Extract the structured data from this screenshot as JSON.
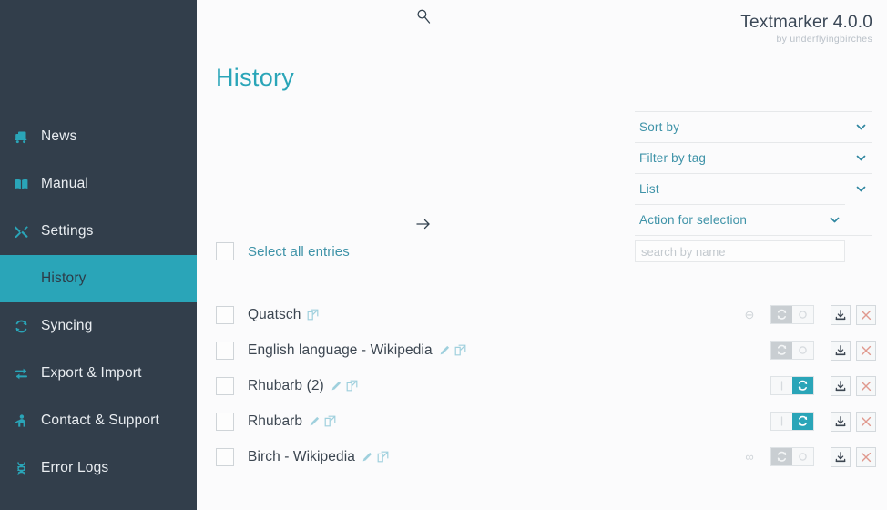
{
  "app": {
    "title": "Textmarker 4.0.0",
    "subtitle": "by underflyingbirches",
    "accent_color": "#2aa5b8",
    "sidebar_color": "#323e4b",
    "background_color": "#fbfbfc"
  },
  "page": {
    "title": "History"
  },
  "sidebar": {
    "items": [
      {
        "label": "News",
        "icon": "news-icon",
        "active": false
      },
      {
        "label": "Manual",
        "icon": "book-icon",
        "active": false
      },
      {
        "label": "Settings",
        "icon": "tools-icon",
        "active": false
      },
      {
        "label": "History",
        "icon": "history-icon",
        "active": true
      },
      {
        "label": "Syncing",
        "icon": "sync-icon",
        "active": false
      },
      {
        "label": "Export & Import",
        "icon": "swap-icon",
        "active": false
      },
      {
        "label": "Contact & Support",
        "icon": "person-icon",
        "active": false
      },
      {
        "label": "Error Logs",
        "icon": "dna-icon",
        "active": false
      }
    ]
  },
  "filters": {
    "sort_by_label": "Sort by",
    "filter_by_tag_label": "Filter by tag",
    "list_label": "List",
    "action_for_selection_label": "Action for selection",
    "go_icon": "arrow-right-icon",
    "chevron_icon": "chevron-down-icon"
  },
  "search": {
    "value": "",
    "placeholder": "search by name",
    "icon": "magnifier-icon"
  },
  "selection": {
    "select_all_label": "Select all entries",
    "checked": false
  },
  "entries": [
    {
      "title": "Quatsch",
      "checked": false,
      "has_edit_icon": false,
      "has_link_icon": true,
      "status_symbol": "⊖",
      "sync_on": false
    },
    {
      "title": "English language - Wikipedia",
      "checked": false,
      "has_edit_icon": true,
      "has_link_icon": true,
      "status_symbol": "",
      "sync_on": false
    },
    {
      "title": "Rhubarb (2)",
      "checked": false,
      "has_edit_icon": true,
      "has_link_icon": true,
      "status_symbol": "",
      "sync_on": true
    },
    {
      "title": "Rhubarb",
      "checked": false,
      "has_edit_icon": true,
      "has_link_icon": true,
      "status_symbol": "",
      "sync_on": true
    },
    {
      "title": "Birch - Wikipedia",
      "checked": false,
      "has_edit_icon": true,
      "has_link_icon": true,
      "status_symbol": "∞",
      "sync_on": false
    }
  ],
  "row_actions": {
    "sync_icon": "sync-icon",
    "download_icon": "download-icon",
    "delete_icon": "close-x-icon",
    "edit_icon": "pencil-icon",
    "link_icon": "external-link-icon"
  }
}
